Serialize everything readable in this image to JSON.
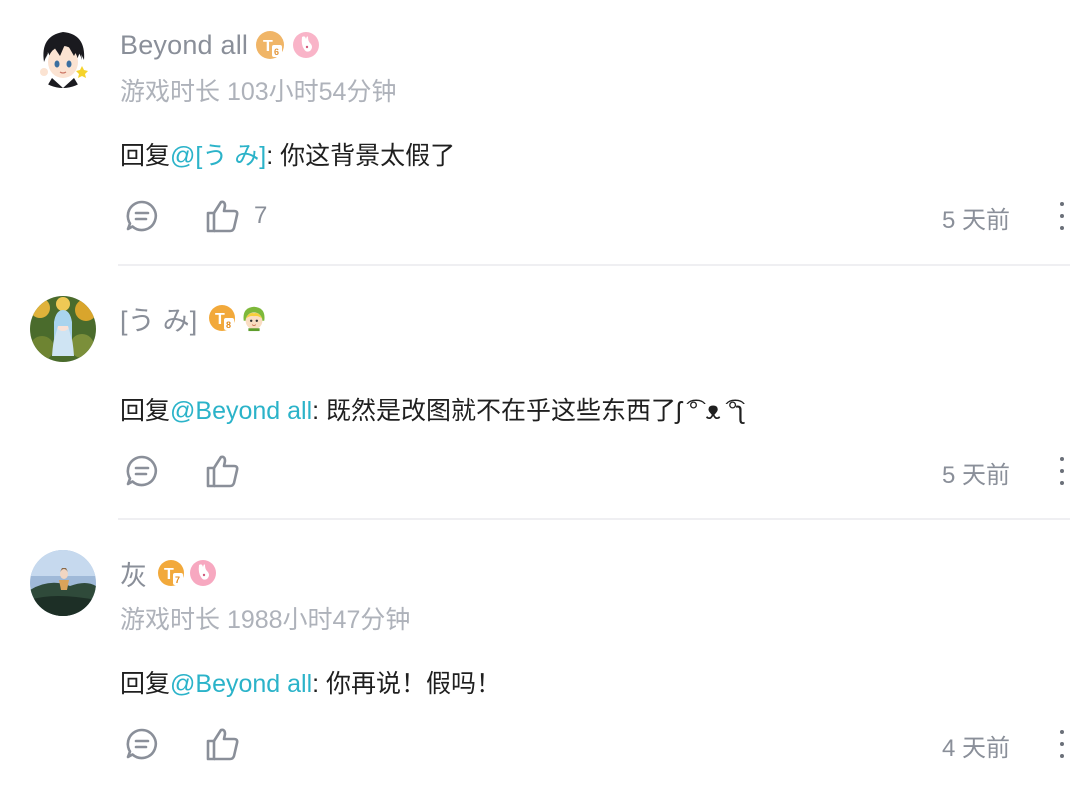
{
  "comments": [
    {
      "username": "Beyond all",
      "playtime": "游戏时长 103小时54分钟",
      "reply_prefix": "回复",
      "mention": "@[う み]",
      "text": ": 你这背景太假了",
      "like_count": "7",
      "time": "5 天前",
      "badges": [
        "level-T6-badge",
        "rabbit-badge"
      ]
    },
    {
      "username": "[う み]",
      "playtime": "",
      "reply_prefix": "回复",
      "mention": "@Beyond all",
      "text": ": 既然是改图就不在乎这些东西了ʃ ͡° ᴥ ͡°ʅ",
      "like_count": "",
      "time": "5 天前",
      "badges": [
        "level-T8-badge",
        "character-badge"
      ]
    },
    {
      "username": "灰",
      "playtime": "游戏时长 1988小时47分钟",
      "reply_prefix": "回复",
      "mention": "@Beyond all",
      "text": ": 你再说！假吗！",
      "like_count": "",
      "time": "4 天前",
      "badges": [
        "level-T7-badge",
        "rabbit-badge"
      ]
    }
  ],
  "badge_labels": {
    "t6": "T",
    "t6_sub": "6",
    "t8": "T",
    "t8_sub": "8",
    "t7": "T",
    "t7_sub": "7"
  },
  "colors": {
    "mention": "#2bb3c9",
    "username": "#8a8f99",
    "muted": "#aeb2ba",
    "badge_orange": "#f2a93b",
    "badge_pink": "#f7a8c0"
  }
}
